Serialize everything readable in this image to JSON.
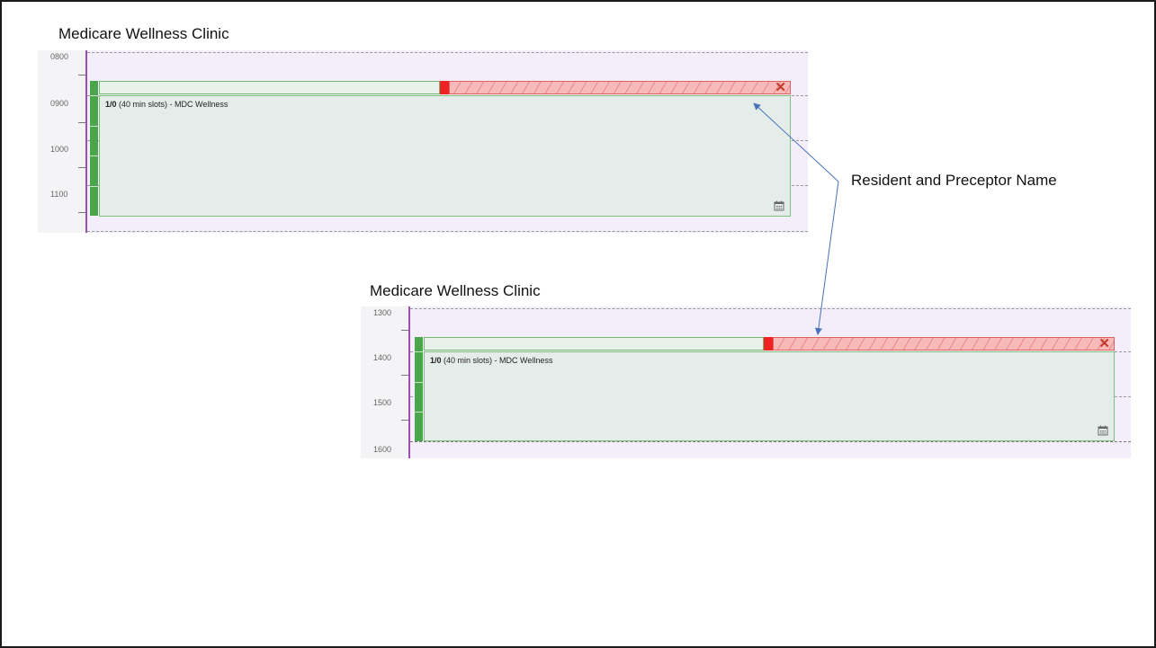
{
  "panels": [
    {
      "clinic_title": "Medicare Wellness Clinic",
      "times": [
        "0800",
        "0900",
        "1000",
        "1100"
      ],
      "slot": {
        "count": "1/0",
        "desc": " (40 min slots) - MDC Wellness"
      }
    },
    {
      "clinic_title": "Medicare Wellness Clinic",
      "times": [
        "1300",
        "1400",
        "1500",
        "1600"
      ],
      "slot": {
        "count": "1/0",
        "desc": " (40 min slots) - MDC Wellness"
      }
    }
  ],
  "annotation": {
    "label": "Resident and Preceptor Name"
  },
  "colors": {
    "slot_green": "#4aa64a",
    "blocked_red": "#ee2222",
    "gutter_line": "#9b4fb5"
  },
  "icons": {
    "close": "close-x-icon",
    "calendar": "calendar-icon"
  }
}
